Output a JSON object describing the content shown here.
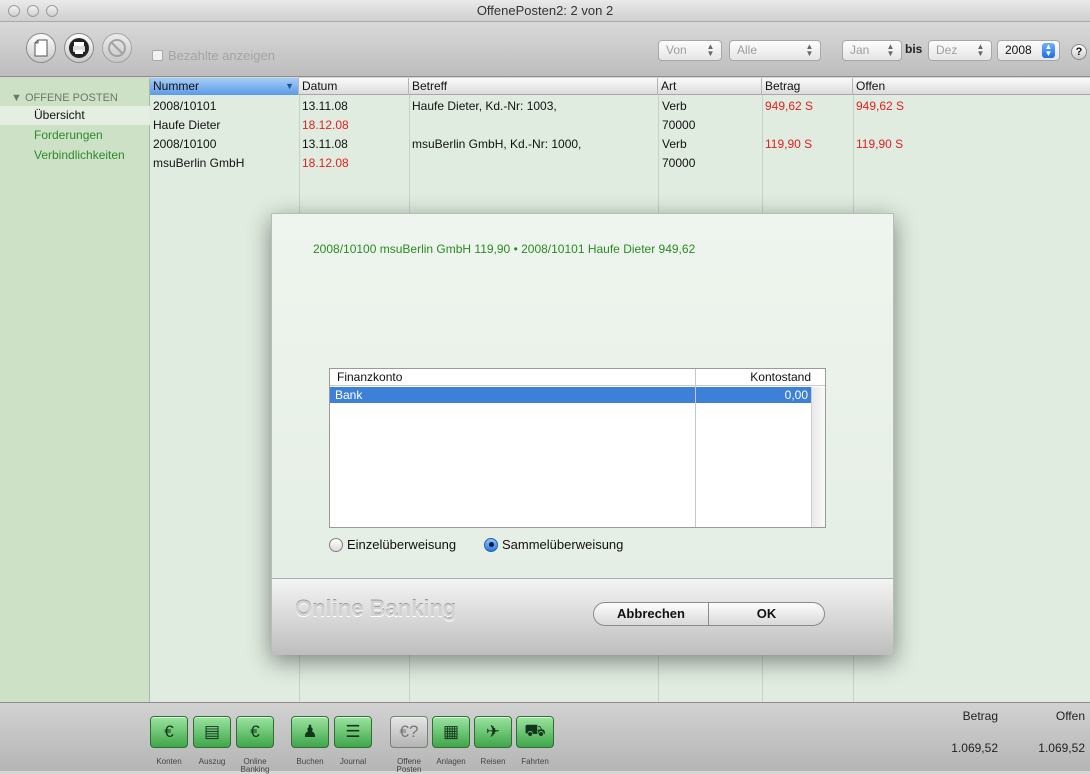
{
  "window": {
    "title": "OffenePosten2: 2 von 2"
  },
  "toolbar": {
    "new_icon": "document-icon",
    "print_icon": "printer-icon",
    "cancel_icon": "cancel-icon",
    "show_paid_label": "Bezahlte anzeigen",
    "filter_von": "Von",
    "filter_alle": "Alle",
    "month_from": "Jan",
    "bis_label": "bis",
    "month_to": "Dez",
    "year": "2008",
    "help_label": "?"
  },
  "sidebar": {
    "section": "OFFENE POSTEN",
    "items": [
      {
        "label": "Übersicht",
        "selected": true
      },
      {
        "label": "Forderungen",
        "selected": false
      },
      {
        "label": "Verbindlichkeiten",
        "selected": false
      }
    ]
  },
  "table": {
    "columns": [
      "Nummer",
      "Datum",
      "Betreff",
      "Art",
      "Betrag",
      "Offen"
    ],
    "rows": [
      {
        "nummer": "2008/10101",
        "datum": "13.11.08",
        "betreff": "Haufe Dieter, Kd.-Nr: 1003,",
        "art": "Verb",
        "betrag": "949,62 S",
        "offen": "949,62 S"
      },
      {
        "nummer": "Haufe Dieter",
        "datum": "18.12.08",
        "betreff": "",
        "art": "70000",
        "betrag": "",
        "offen": ""
      },
      {
        "nummer": "2008/10100",
        "datum": "13.11.08",
        "betreff": "msuBerlin GmbH, Kd.-Nr: 1000,",
        "art": "Verb",
        "betrag": "119,90 S",
        "offen": "119,90 S"
      },
      {
        "nummer": "msuBerlin GmbH",
        "datum": "18.12.08",
        "betreff": "",
        "art": "70000",
        "betrag": "",
        "offen": ""
      }
    ]
  },
  "dialog": {
    "summary": "2008/10100 msuBerlin GmbH 119,90 • 2008/10101 Haufe Dieter 949,62",
    "table_headers": [
      "Finanzkonto",
      "Kontostand"
    ],
    "account": {
      "name": "Bank",
      "balance": "0,00"
    },
    "radio_single": "Einzelüberweisung",
    "radio_collective": "Sammelüberweisung",
    "logo": "Online Banking",
    "cancel": "Abbrechen",
    "ok": "OK"
  },
  "footer": {
    "icons": [
      {
        "label": "Konten",
        "icon": "euro-notes-icon"
      },
      {
        "label": "Auszug",
        "icon": "statement-icon"
      },
      {
        "label": "Online Banking",
        "icon": "euro-coin-icon"
      },
      {
        "label": "Buchen",
        "icon": "stamp-icon"
      },
      {
        "label": "Journal",
        "icon": "journal-icon"
      },
      {
        "label": "Offene Posten",
        "icon": "open-items-icon"
      },
      {
        "label": "Anlagen",
        "icon": "assets-icon"
      },
      {
        "label": "Reisen",
        "icon": "plane-icon"
      },
      {
        "label": "Fahrten",
        "icon": "car-icon"
      }
    ],
    "totals": {
      "betrag_label": "Betrag",
      "offen_label": "Offen",
      "betrag_value": "1.069,52",
      "offen_value": "1.069,52"
    }
  },
  "colors": {
    "accent_green": "#2b8a22",
    "amount_red": "#e22020",
    "selection_blue": "#3d80d8"
  }
}
